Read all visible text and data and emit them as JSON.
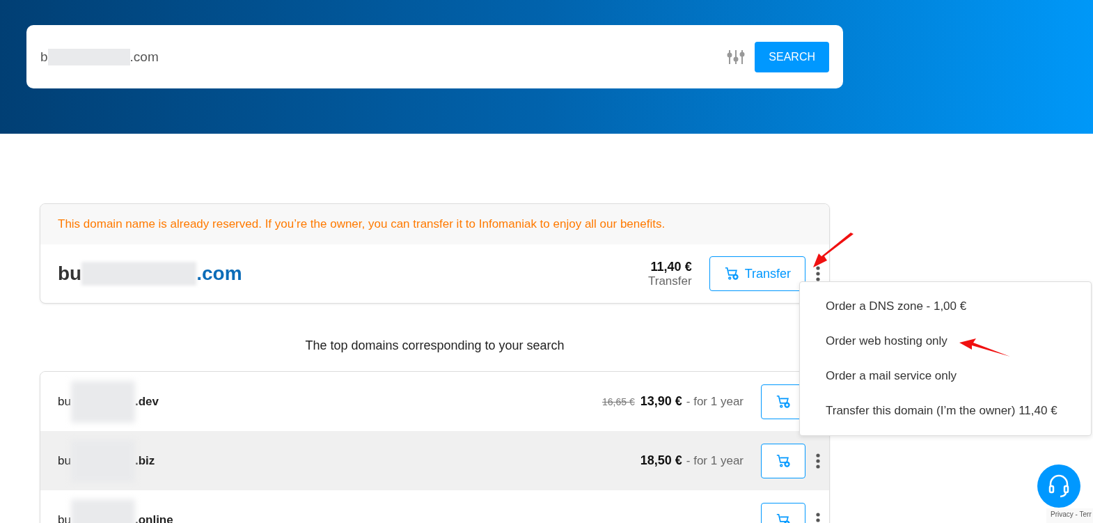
{
  "search": {
    "value_prefix": "b",
    "value_suffix": ".com",
    "button": "SEARCH"
  },
  "reserved": {
    "notice": "This domain name is already reserved. If you’re the owner, you can transfer it to Infomaniak to enjoy all our benefits.",
    "domain_prefix": "bu",
    "domain_suffix": ".com",
    "price": "11,40 €",
    "price_label": "Transfer",
    "button": "Transfer"
  },
  "menu": {
    "open": true,
    "items": [
      "Order a DNS zone - 1,00 €",
      "Order web hosting only",
      "Order a mail service only",
      "Transfer this domain (I’m the owner) 11,40 €"
    ]
  },
  "top_heading": "The top domains corresponding to your search",
  "domains": [
    {
      "prefix": "bu",
      "suffix": ".dev",
      "old_price": "16,65 €",
      "price": "13,90 €",
      "period": "- for 1 year",
      "hovered": false
    },
    {
      "prefix": "bu",
      "suffix": ".biz",
      "price": "18,50 €",
      "period": "- for 1 year",
      "hovered": true
    },
    {
      "prefix": "bu",
      "suffix": ".online",
      "hovered": false
    }
  ],
  "recaptcha": {
    "text": "Privacy - Terr"
  }
}
